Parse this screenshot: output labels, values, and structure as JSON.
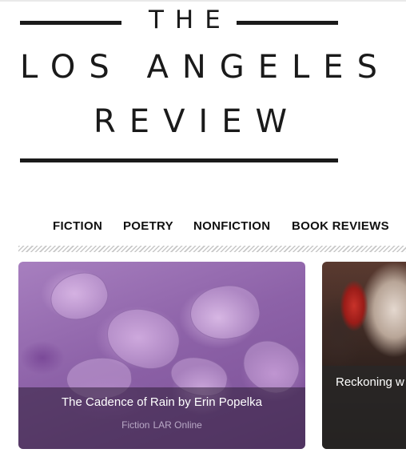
{
  "logo": {
    "line1": "THE",
    "line2": "LOS ANGELES",
    "line3": "REVIEW"
  },
  "nav": {
    "items": [
      {
        "label": "FICTION"
      },
      {
        "label": "POETRY"
      },
      {
        "label": "NONFICTION"
      },
      {
        "label": "BOOK REVIEWS"
      }
    ]
  },
  "cards": [
    {
      "title": "The Cadence of Rain by Erin Popelka",
      "categories": [
        "Fiction",
        "LAR Online"
      ]
    },
    {
      "title": "Reckoning w"
    }
  ],
  "colors": {
    "text": "#1a1a1a",
    "card_overlay": "#2d1e37",
    "meta_text": "#b9a9c6"
  }
}
